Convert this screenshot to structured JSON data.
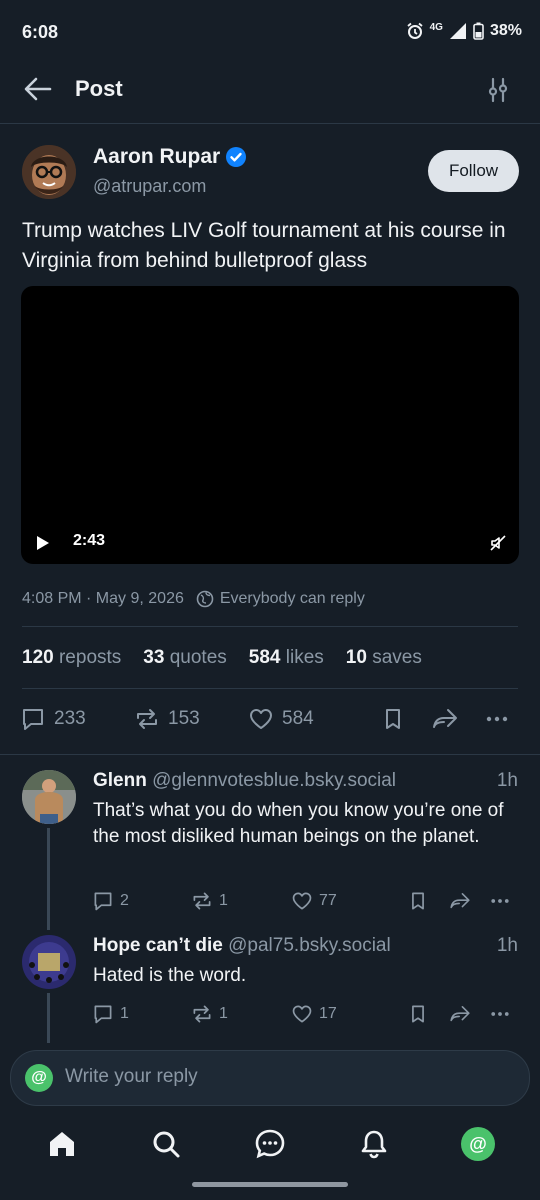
{
  "status_bar": {
    "time": "6:08",
    "network": "4G",
    "battery": "38%"
  },
  "header": {
    "title": "Post"
  },
  "post": {
    "author_name": "Aaron Rupar",
    "author_handle": "@atrupar.com",
    "follow_label": "Follow",
    "text": "Trump watches LIV Golf tournament at his course in Virginia from behind bulletproof glass",
    "video_duration": "2:43",
    "timestamp": "4:08 PM · May 9, 2026",
    "reply_setting": "Everybody can reply",
    "stats": {
      "reposts_count": "120",
      "reposts_label": "reposts",
      "quotes_count": "33",
      "quotes_label": "quotes",
      "likes_count": "584",
      "likes_label": "likes",
      "saves_count": "10",
      "saves_label": "saves"
    },
    "actions": {
      "replies": "233",
      "reposts": "153",
      "likes": "584"
    }
  },
  "replies": [
    {
      "name": "Glenn",
      "handle": "@glennvotesblue.bsky.social",
      "time": "1h",
      "text": "That’s what you do when you know you’re one of the most disliked human beings on the planet.",
      "replies": "2",
      "reposts": "1",
      "likes": "77"
    },
    {
      "name": "Hope can’t die",
      "handle": "@pal75.bsky.social",
      "time": "1h",
      "text": "Hated is the word.",
      "replies": "1",
      "reposts": "1",
      "likes": "17"
    }
  ],
  "compose": {
    "placeholder": "Write your reply",
    "icon_glyph": "@"
  },
  "nav": {
    "profile_glyph": "@"
  },
  "colors": {
    "background": "#161e27",
    "verified": "#1083fe",
    "accent_green": "#4ac26b",
    "muted": "#8b98a5"
  }
}
